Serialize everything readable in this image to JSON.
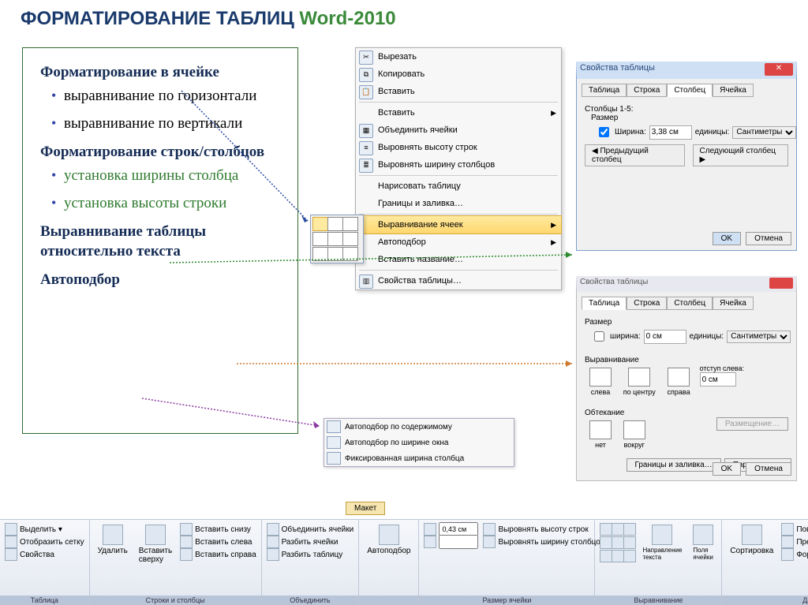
{
  "title": {
    "part1": "ФОРМАТИРОВАНИЕ ТАБЛИЦ ",
    "part2": "Word-2010"
  },
  "textbox": {
    "h1": "Форматирование в ячейке",
    "b1": "выравнивание по горизонтали",
    "b2": "выравнивание по вертикали",
    "h2": "Форматирование строк/столбцов",
    "b3": "установка ширины столбца",
    "b4": "установка высоты строки",
    "h3": "Выравнивание таблицы относительно текста",
    "h4": " Автоподбор"
  },
  "menu": {
    "cut": "Вырезать",
    "copy": "Копировать",
    "paste": "Вставить",
    "insert": "Вставить",
    "merge": "Объединить ячейки",
    "rowh": "Выровнять высоту строк",
    "colw": "Выровнять ширину столбцов",
    "draw": "Нарисовать таблицу",
    "borders": "Границы и заливка…",
    "align": "Выравнивание ячеек",
    "autofit": "Автоподбор",
    "caption": "Вставить название…",
    "props": "Свойства таблицы…"
  },
  "props1": {
    "title": "Свойства таблицы",
    "tabs": [
      "Таблица",
      "Строка",
      "Столбец",
      "Ячейка"
    ],
    "group": "Столбцы 1-5:",
    "sizelbl": "Размер",
    "widthchk": "Ширина:",
    "widthval": "3,38 см",
    "unitslbl": "единицы:",
    "unitsval": "Сантиметры",
    "prev": "Предыдущий столбец",
    "next": "Следующий столбец",
    "ok": "OK",
    "cancel": "Отмена"
  },
  "props2": {
    "title": "Свойства таблицы",
    "tabs": [
      "Таблица",
      "Строка",
      "Столбец",
      "Ячейка"
    ],
    "sizelbl": "Размер",
    "widthchk": "ширина:",
    "widthval": "0 см",
    "unitslbl": "единицы:",
    "unitsval": "Сантиметры",
    "alignlbl": "Выравнивание",
    "a1": "слева",
    "a2": "по центру",
    "a3": "справа",
    "indentlbl": "отступ слева:",
    "indentval": "0 см",
    "wraplbl": "Обтекание",
    "w1": "нет",
    "w2": "вокруг",
    "place": "Размещение…",
    "borders": "Границы и заливка…",
    "params": "Параметры…",
    "ok": "OK",
    "cancel": "Отмена"
  },
  "autopop": {
    "a": "Автоподбор по содержимому",
    "b": "Автоподбор по ширине окна",
    "c": "Фиксированная ширина столбца"
  },
  "ribbon": {
    "tab": "Макет",
    "g1": "Таблица",
    "g1a": "Выделить ▾",
    "g1b": "Отобразить сетку",
    "g1c": "Свойства",
    "g2": "Строки и столбцы",
    "g2a": "Удалить",
    "g2b": "Вставить сверху",
    "g2c": "Вставить снизу",
    "g2d": "Вставить слева",
    "g2e": "Вставить справа",
    "g3": "Объединить",
    "g3a": "Объединить ячейки",
    "g3b": "Разбить ячейки",
    "g3c": "Разбить таблицу",
    "g4lbl": "Автоподбор",
    "g5": "Размер ячейки",
    "g5a": "0,43 см",
    "g5b": "Выровнять высоту строк",
    "g5c": "Выровнять ширину столбцов",
    "g6": "Выравнивание",
    "g6a": "Направление текста",
    "g6b": "Поля ячейки",
    "g7": "Данные",
    "g7a": "Сортировка",
    "g7b": "Повторить строки заголовков",
    "g7c": "Преобразовать в текст",
    "g7d": "Формула"
  }
}
